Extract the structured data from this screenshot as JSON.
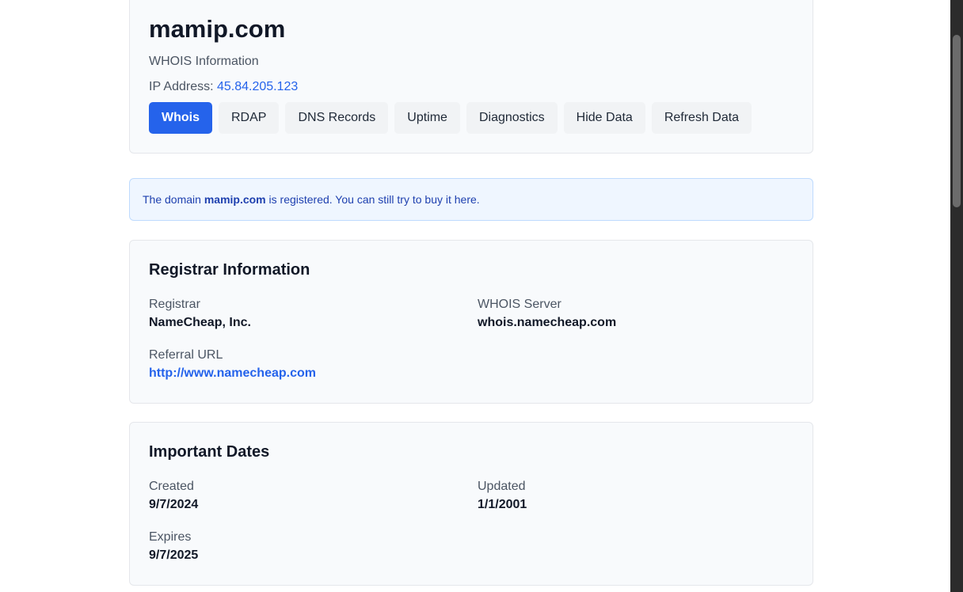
{
  "header": {
    "domain": "mamip.com",
    "subtitle": "WHOIS Information",
    "ip_label": "IP Address: ",
    "ip_value": "45.84.205.123"
  },
  "buttons": [
    {
      "label": "Whois",
      "active": true
    },
    {
      "label": "RDAP",
      "active": false
    },
    {
      "label": "DNS Records",
      "active": false
    },
    {
      "label": "Uptime",
      "active": false
    },
    {
      "label": "Diagnostics",
      "active": false
    },
    {
      "label": "Hide Data",
      "active": false
    },
    {
      "label": "Refresh Data",
      "active": false
    }
  ],
  "notice": {
    "prefix": "The domain ",
    "domain": "mamip.com",
    "middle": " is registered. You can still try to buy it ",
    "link": "here",
    "suffix": "."
  },
  "registrar": {
    "title": "Registrar Information",
    "registrar_label": "Registrar",
    "registrar_value": "NameCheap, Inc.",
    "whois_label": "WHOIS Server",
    "whois_value": "whois.namecheap.com",
    "referral_label": "Referral URL",
    "referral_value": "http://www.namecheap.com"
  },
  "dates": {
    "title": "Important Dates",
    "created_label": "Created",
    "created_value": "9/7/2024",
    "updated_label": "Updated",
    "updated_value": "1/1/2001",
    "expires_label": "Expires",
    "expires_value": "9/7/2025"
  },
  "colors": {
    "accent": "#2563eb",
    "notice_bg": "#eff6ff",
    "card_bg": "#f8fafc"
  }
}
